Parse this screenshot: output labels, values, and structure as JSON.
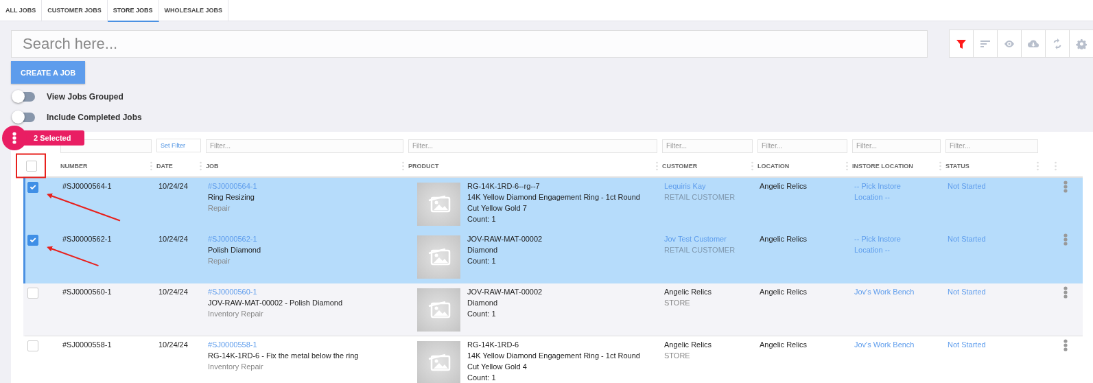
{
  "tabs": [
    {
      "label": "ALL JOBS",
      "selected": false
    },
    {
      "label": "CUSTOMER JOBS",
      "selected": false
    },
    {
      "label": "STORE JOBS",
      "selected": true
    },
    {
      "label": "WHOLESALE JOBS",
      "selected": false
    }
  ],
  "search": {
    "placeholder": "Search here..."
  },
  "toolbar": [
    {
      "kind": "filter",
      "active": true
    },
    {
      "kind": "sort",
      "active": false
    },
    {
      "kind": "view",
      "active": false
    },
    {
      "kind": "download",
      "active": false
    },
    {
      "kind": "refresh",
      "active": false
    },
    {
      "kind": "settings",
      "active": false
    }
  ],
  "create_button": "CREATE A JOB",
  "toggles": [
    {
      "label": "View Jobs Grouped",
      "on": false
    },
    {
      "label": "Include Completed Jobs",
      "on": false
    }
  ],
  "selection_badge": "2 Selected",
  "filters": [
    {
      "kind": "input"
    },
    {
      "kind": "link",
      "label": "Set Filter"
    },
    {
      "kind": "input",
      "placeholder": "Filter..."
    },
    {
      "kind": "input",
      "placeholder": "Filter..."
    },
    {
      "kind": "input",
      "placeholder": "Filter..."
    },
    {
      "kind": "input",
      "placeholder": "Filter..."
    },
    {
      "kind": "input",
      "placeholder": "Filter..."
    },
    {
      "kind": "input",
      "placeholder": "Filter..."
    }
  ],
  "header_checkbox": {
    "checked": false,
    "highlighted": true
  },
  "columns": [
    "NUMBER",
    "DATE",
    "JOB",
    "PRODUCT",
    "CUSTOMER",
    "LOCATION",
    "INSTORE LOCATION",
    "STATUS"
  ],
  "rows": [
    {
      "selected": true,
      "arrow": true,
      "number": "#SJ0000564-1",
      "date": "10/24/24",
      "job_link": "#SJ0000564-1",
      "job_title": "Ring Resizing",
      "job_type": "Repair",
      "product": [
        "RG-14K-1RD-6--rg--7",
        "14K Yellow Diamond Engagement Ring - 1ct Round",
        "Cut Yellow Gold 7",
        "Count: 1"
      ],
      "customer_link": true,
      "customer": "Lequiris Kay",
      "customer_type": "RETAIL CUSTOMER",
      "location": "Angelic Relics",
      "instore_location": "-- Pick Instore Location --",
      "status": "Not Started"
    },
    {
      "selected": true,
      "arrow": true,
      "number": "#SJ0000562-1",
      "date": "10/24/24",
      "job_link": "#SJ0000562-1",
      "job_title": "Polish Diamond",
      "job_type": "Repair",
      "product": [
        "JOV-RAW-MAT-00002",
        "Diamond",
        "Count: 1"
      ],
      "customer_link": true,
      "customer": "Jov Test Customer",
      "customer_type": "RETAIL CUSTOMER",
      "location": "Angelic Relics",
      "instore_location": "-- Pick Instore Location --",
      "status": "Not Started"
    },
    {
      "selected": false,
      "arrow": false,
      "number": "#SJ0000560-1",
      "date": "10/24/24",
      "job_link": "#SJ0000560-1",
      "job_title": "JOV-RAW-MAT-00002 - Polish Diamond",
      "job_type": "Inventory Repair",
      "product": [
        "JOV-RAW-MAT-00002",
        "Diamond",
        "Count: 1"
      ],
      "customer_link": false,
      "customer": "Angelic Relics",
      "customer_type": "STORE",
      "location": "Angelic Relics",
      "instore_location": "Jov's Work Bench",
      "status": "Not Started"
    },
    {
      "selected": false,
      "arrow": false,
      "number": "#SJ0000558-1",
      "date": "10/24/24",
      "job_link": "#SJ0000558-1",
      "job_title": "RG-14K-1RD-6 - Fix the metal below the ring",
      "job_type": "Inventory Repair",
      "product": [
        "RG-14K-1RD-6",
        "14K Yellow Diamond Engagement Ring - 1ct Round",
        "Cut Yellow Gold 4",
        "Count: 1"
      ],
      "customer_link": false,
      "customer": "Angelic Relics",
      "customer_type": "STORE",
      "location": "Angelic Relics",
      "instore_location": "Jov's Work Bench",
      "status": "Not Started"
    }
  ]
}
